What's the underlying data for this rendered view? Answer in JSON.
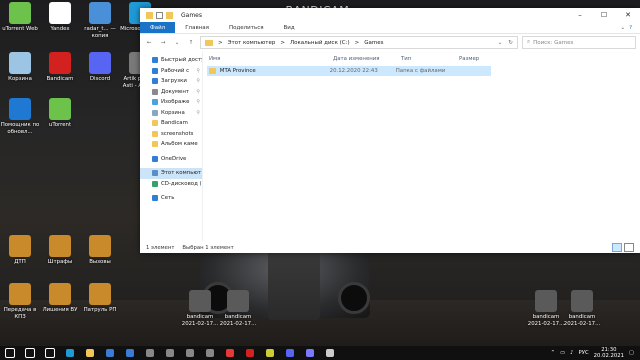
{
  "watermark": "www.BANDICAM.com",
  "desktop": {
    "icons": [
      {
        "label": "uTorrent Web",
        "color": "#6cc24a"
      },
      {
        "label": "Yandex",
        "color": "#ffffff"
      },
      {
        "label": "radar_t... — копия",
        "color": "#4a90d9"
      },
      {
        "label": "Microsoft Edge",
        "color": "#1f9ad6"
      },
      {
        "label": "Корзина",
        "color": "#9cc4e4"
      },
      {
        "label": "Bandicam",
        "color": "#d2211f"
      },
      {
        "label": "Discord",
        "color": "#5865f2"
      },
      {
        "label": "Artik project Asti - Asti -...",
        "color": "#7a7a7a"
      },
      {
        "label": "Помощник по обновл...",
        "color": "#1f78d1"
      },
      {
        "label": "uTorrent",
        "color": "#6cc24a"
      },
      {
        "label": "ДТП",
        "color": "#c98a2c"
      },
      {
        "label": "Штрафы",
        "color": "#c98a2c"
      },
      {
        "label": "Вызовы",
        "color": "#c98a2c"
      },
      {
        "label": "Передача в КПЗ",
        "color": "#c98a2c"
      },
      {
        "label": "Лишения ВУ",
        "color": "#c98a2c"
      },
      {
        "label": "Патруль РП",
        "color": "#c98a2c"
      },
      {
        "label": "bandicam 2021-02-17...",
        "color": "#5a5a5a"
      },
      {
        "label": "bandicam 2021-02-17...",
        "color": "#5a5a5a"
      },
      {
        "label": "bandicam 2021-02-17...",
        "color": "#5a5a5a"
      },
      {
        "label": "bandicam 2021-02-17...",
        "color": "#5a5a5a"
      }
    ]
  },
  "explorer": {
    "title": "Games",
    "window_controls": [
      "–",
      "☐",
      "✕"
    ],
    "ribbon_tabs": [
      "Файл",
      "Главная",
      "Поделиться",
      "Вид"
    ],
    "nav": {
      "back": "←",
      "forward": "→",
      "up": "↑"
    },
    "address": {
      "parts": [
        "Этот компьютер",
        "Локальный диск (C:)",
        "Games"
      ],
      "separator": ">"
    },
    "search_placeholder": "Поиск: Games",
    "sidebar": [
      {
        "label": "Быстрый досту",
        "icon": "star-icon",
        "color": "#2f7fd6"
      },
      {
        "label": "Рабочий с",
        "icon": "desktop-icon",
        "color": "#2f7fd6"
      },
      {
        "label": "Загрузки",
        "icon": "download-icon",
        "color": "#2f7fd6"
      },
      {
        "label": "Документ",
        "icon": "document-icon",
        "color": "#8a8a8a"
      },
      {
        "label": "Изображе",
        "icon": "image-icon",
        "color": "#4aa3df"
      },
      {
        "label": "Корзина",
        "icon": "recycle-bin-icon",
        "color": "#8aa7c0"
      },
      {
        "label": "Bandicam",
        "icon": "folder-icon",
        "color": "#f3c65a"
      },
      {
        "label": "screenshots",
        "icon": "folder-icon",
        "color": "#f3c65a"
      },
      {
        "label": "Альбом каме",
        "icon": "folder-icon",
        "color": "#f3c65a"
      },
      {
        "label": "OneDrive",
        "icon": "cloud-icon",
        "color": "#2f7fd6"
      },
      {
        "label": "Этот компьют",
        "icon": "computer-icon",
        "color": "#5a8fc6"
      },
      {
        "label": "CD-дисковод (I",
        "icon": "disc-icon",
        "color": "#38a169"
      },
      {
        "label": "Сеть",
        "icon": "network-icon",
        "color": "#2f7fd6"
      }
    ],
    "columns": [
      "Имя",
      "Дата изменения",
      "Тип",
      "Размер"
    ],
    "rows": [
      {
        "name": "MTA Province",
        "date": "20.12.2020 22:43",
        "type": "Папка с файлами",
        "size": ""
      }
    ],
    "status": {
      "count": "1 элемент",
      "selected": "Выбран 1 элемент"
    }
  },
  "taskbar": {
    "items": [
      {
        "name": "start",
        "color": "#ffffff"
      },
      {
        "name": "search",
        "color": "#ffffff"
      },
      {
        "name": "task-view",
        "color": "#ffffff"
      },
      {
        "name": "edge",
        "color": "#1f9ad6"
      },
      {
        "name": "explorer",
        "color": "#f3c65a"
      },
      {
        "name": "store",
        "color": "#3a7bd5"
      },
      {
        "name": "mail",
        "color": "#3a7bd5"
      },
      {
        "name": "app",
        "color": "#888888"
      },
      {
        "name": "app",
        "color": "#888888"
      },
      {
        "name": "app",
        "color": "#888888"
      },
      {
        "name": "app",
        "color": "#888888"
      },
      {
        "name": "yandex",
        "color": "#e53935"
      },
      {
        "name": "bandicam",
        "color": "#d2211f"
      },
      {
        "name": "app",
        "color": "#cccc33"
      },
      {
        "name": "discord",
        "color": "#5865f2"
      },
      {
        "name": "app",
        "color": "#7a7aff"
      },
      {
        "name": "app",
        "color": "#cccccc"
      }
    ],
    "language": "РУС",
    "time": "21:30",
    "date": "20.02.2021"
  }
}
